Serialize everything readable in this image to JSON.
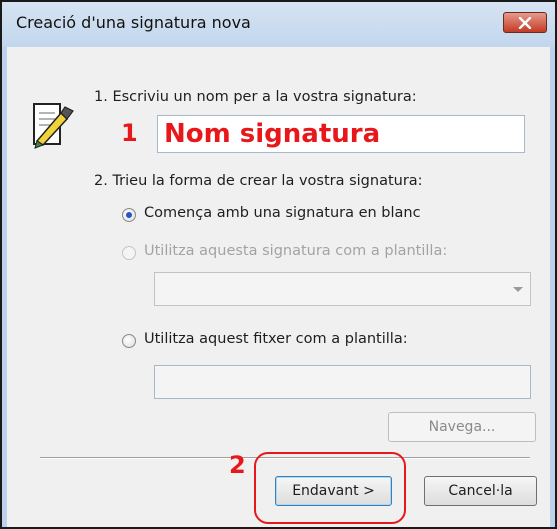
{
  "window": {
    "title": "Creació d'una signatura nova"
  },
  "icons": {
    "close": "close-icon",
    "signature": "signature-edit-icon"
  },
  "step1": {
    "label": "1. Escriviu un nom per a la vostra signatura:",
    "callout": "1",
    "name_value": "Nom signatura"
  },
  "step2": {
    "label": "2. Trieu la forma de crear la vostra signatura:",
    "options": [
      {
        "label": "Comença amb una signatura en blanc",
        "checked": true,
        "enabled": true
      },
      {
        "label": "Utilitza aquesta signatura com a plantilla:",
        "checked": false,
        "enabled": false
      },
      {
        "label": "Utilitza aquest fitxer com a plantilla:",
        "checked": false,
        "enabled": true
      }
    ],
    "template_select_value": "",
    "file_path_value": ""
  },
  "buttons": {
    "browse": "Navega...",
    "next": "Endavant >",
    "cancel": "Cancel·la",
    "callout": "2"
  },
  "colors": {
    "callout_red": "#e8181a",
    "title_bar": "#c2d6ec",
    "dialog_bg": "#f0f0f0"
  }
}
